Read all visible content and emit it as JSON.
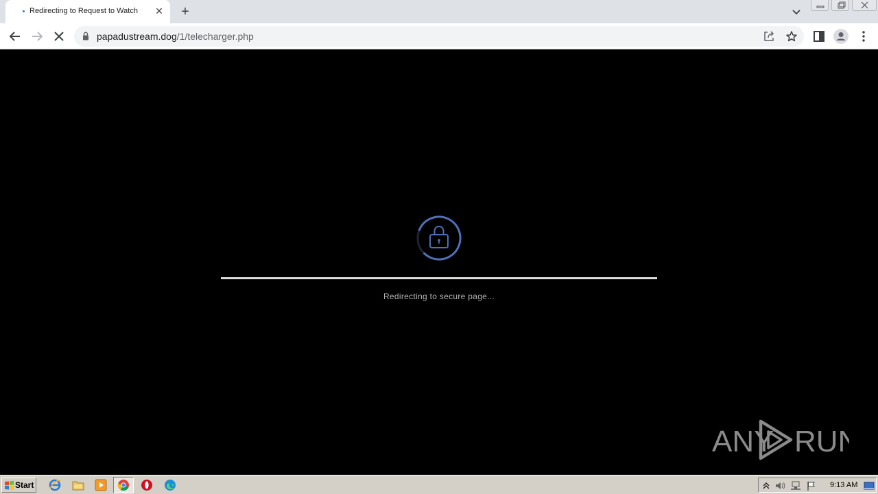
{
  "browser": {
    "tab": {
      "title": "Redirecting to Request to Watch"
    },
    "address": {
      "host": "papadustream.dog",
      "path": "/1/telecharger.php"
    }
  },
  "page": {
    "status_text": "Redirecting to secure page...",
    "progress": 1.0,
    "accent_color": "#4f6fb8",
    "icon": "padlock-icon"
  },
  "watermark": {
    "text_left": "ANY",
    "text_right": "RUN"
  },
  "taskbar": {
    "start_label": "Start",
    "clock": "9:13 AM",
    "pinned": [
      "internet-explorer-icon",
      "folder-icon",
      "media-player-icon",
      "chrome-icon",
      "opera-icon",
      "edge-icon"
    ]
  }
}
